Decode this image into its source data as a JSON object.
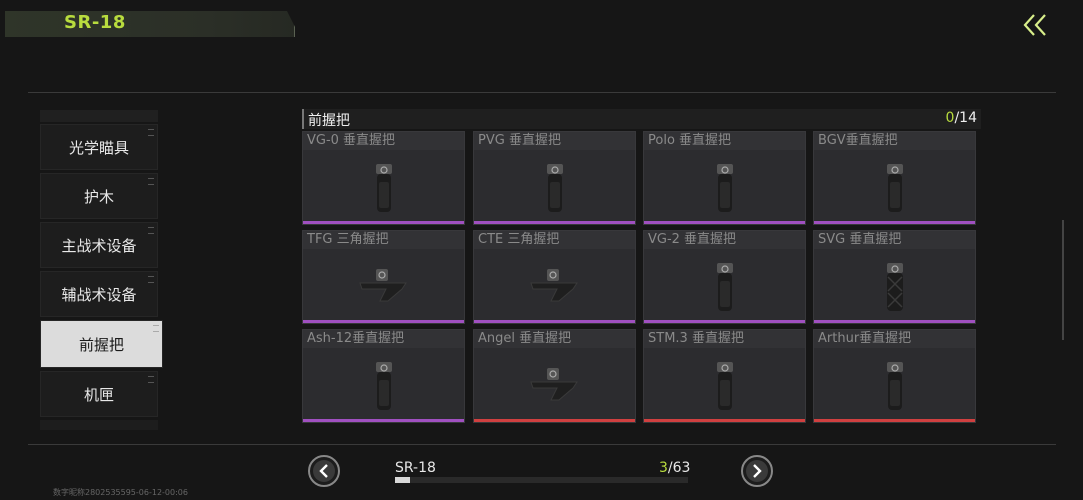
{
  "header": {
    "title": "SR-18",
    "back_icon": "double-chevron-left-icon"
  },
  "sidebar": {
    "items": [
      {
        "label": "光学瞄具",
        "active": false
      },
      {
        "label": "护木",
        "active": false
      },
      {
        "label": "主战术设备",
        "active": false
      },
      {
        "label": "辅战术设备",
        "active": false
      },
      {
        "label": "前握把",
        "active": true
      },
      {
        "label": "机匣",
        "active": false
      }
    ]
  },
  "panel": {
    "title": "前握把",
    "count_current": "0",
    "count_total": "/14",
    "items": [
      {
        "name": "VG-0 垂直握把",
        "bar_color": "#a050c0",
        "icon": "vertical-grip-icon"
      },
      {
        "name": "PVG 垂直握把",
        "bar_color": "#a050c0",
        "icon": "vertical-grip-icon"
      },
      {
        "name": "Polo 垂直握把",
        "bar_color": "#a050c0",
        "icon": "vertical-grip-icon"
      },
      {
        "name": "BGV垂直握把",
        "bar_color": "#a050c0",
        "icon": "vertical-grip-icon"
      },
      {
        "name": "TFG 三角握把",
        "bar_color": "#a050c0",
        "icon": "angled-grip-icon"
      },
      {
        "name": "CTE 三角握把",
        "bar_color": "#a050c0",
        "icon": "angled-grip-icon"
      },
      {
        "name": "VG-2 垂直握把",
        "bar_color": "#a050c0",
        "icon": "vertical-grip-icon"
      },
      {
        "name": "SVG 垂直握把",
        "bar_color": "#a050c0",
        "icon": "textured-grip-icon"
      },
      {
        "name": "Ash-12垂直握把",
        "bar_color": "#a050c0",
        "icon": "vertical-grip-icon"
      },
      {
        "name": "Angel 垂直握把",
        "bar_color": "#d04040",
        "icon": "angled-grip-icon"
      },
      {
        "name": "STM.3 垂直握把",
        "bar_color": "#d04040",
        "icon": "vertical-grip-icon"
      },
      {
        "name": "Arthur垂直握把",
        "bar_color": "#d04040",
        "icon": "vertical-grip-icon"
      }
    ]
  },
  "footer": {
    "weapon_name": "SR-18",
    "weapon_count_current": "3",
    "weapon_count_total": "/63",
    "progress": 0.05,
    "prev_icon": "chevron-left-icon",
    "next_icon": "chevron-right-icon",
    "watermark": "数字昵称2802535595-06-12-00:06"
  },
  "colors": {
    "accent": "#b8dc3e",
    "epic": "#a050c0",
    "legendary": "#d04040"
  }
}
